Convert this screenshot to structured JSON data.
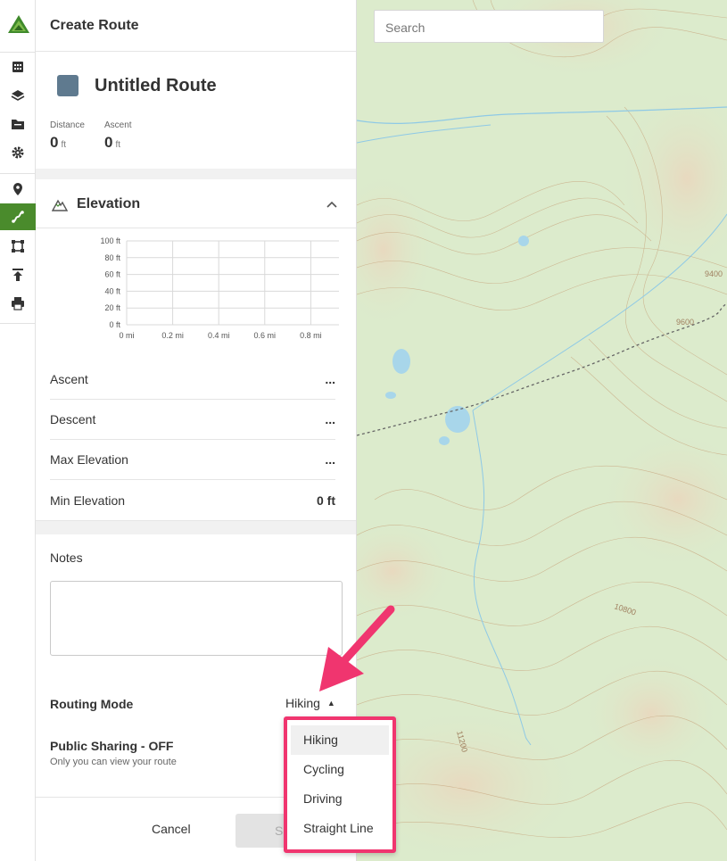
{
  "sidebar": {
    "logo_icon": "gaia-logo-icon",
    "items": [
      {
        "name": "calendar-icon"
      },
      {
        "name": "layers-icon"
      },
      {
        "name": "folder-icon"
      },
      {
        "name": "gear-icon"
      },
      {
        "name": "waypoint-icon"
      },
      {
        "name": "route-icon",
        "active": true
      },
      {
        "name": "area-icon"
      },
      {
        "name": "upload-icon"
      },
      {
        "name": "print-icon"
      }
    ],
    "active_color": "#4a8b2c"
  },
  "panel": {
    "header_title": "Create Route",
    "route": {
      "title": "Untitled Route",
      "color": "#5f7a8f"
    },
    "stats": [
      {
        "label": "Distance",
        "value": "0",
        "unit": "ft"
      },
      {
        "label": "Ascent",
        "value": "0",
        "unit": "ft"
      }
    ],
    "elevation": {
      "title": "Elevation",
      "rows": [
        {
          "label": "Ascent",
          "value": "..."
        },
        {
          "label": "Descent",
          "value": "..."
        },
        {
          "label": "Max Elevation",
          "value": "..."
        },
        {
          "label": "Min Elevation",
          "value": "0 ft"
        }
      ]
    },
    "notes_label": "Notes",
    "routing_mode": {
      "label": "Routing Mode",
      "value": "Hiking"
    },
    "public_sharing": {
      "label": "Public Sharing - OFF",
      "sub": "Only you can view your route"
    },
    "footer": {
      "cancel": "Cancel",
      "save": "S"
    }
  },
  "chart_data": {
    "type": "line",
    "x_ticks": [
      "0 mi",
      "0.2 mi",
      "0.4 mi",
      "0.6 mi",
      "0.8 mi"
    ],
    "y_ticks": [
      "0 ft",
      "20 ft",
      "40 ft",
      "60 ft",
      "80 ft",
      "100 ft"
    ],
    "xlim": [
      0,
      1
    ],
    "ylim": [
      0,
      100
    ],
    "series": [],
    "grid": true
  },
  "map": {
    "search_placeholder": "Search",
    "contour_labels": [
      "9400",
      "9600",
      "10800",
      "11200"
    ],
    "background": "#dcebcc"
  },
  "dropdown": {
    "options": [
      "Hiking",
      "Cycling",
      "Driving",
      "Straight Line"
    ],
    "selected": "Hiking",
    "highlight_color": "#f0356f"
  }
}
